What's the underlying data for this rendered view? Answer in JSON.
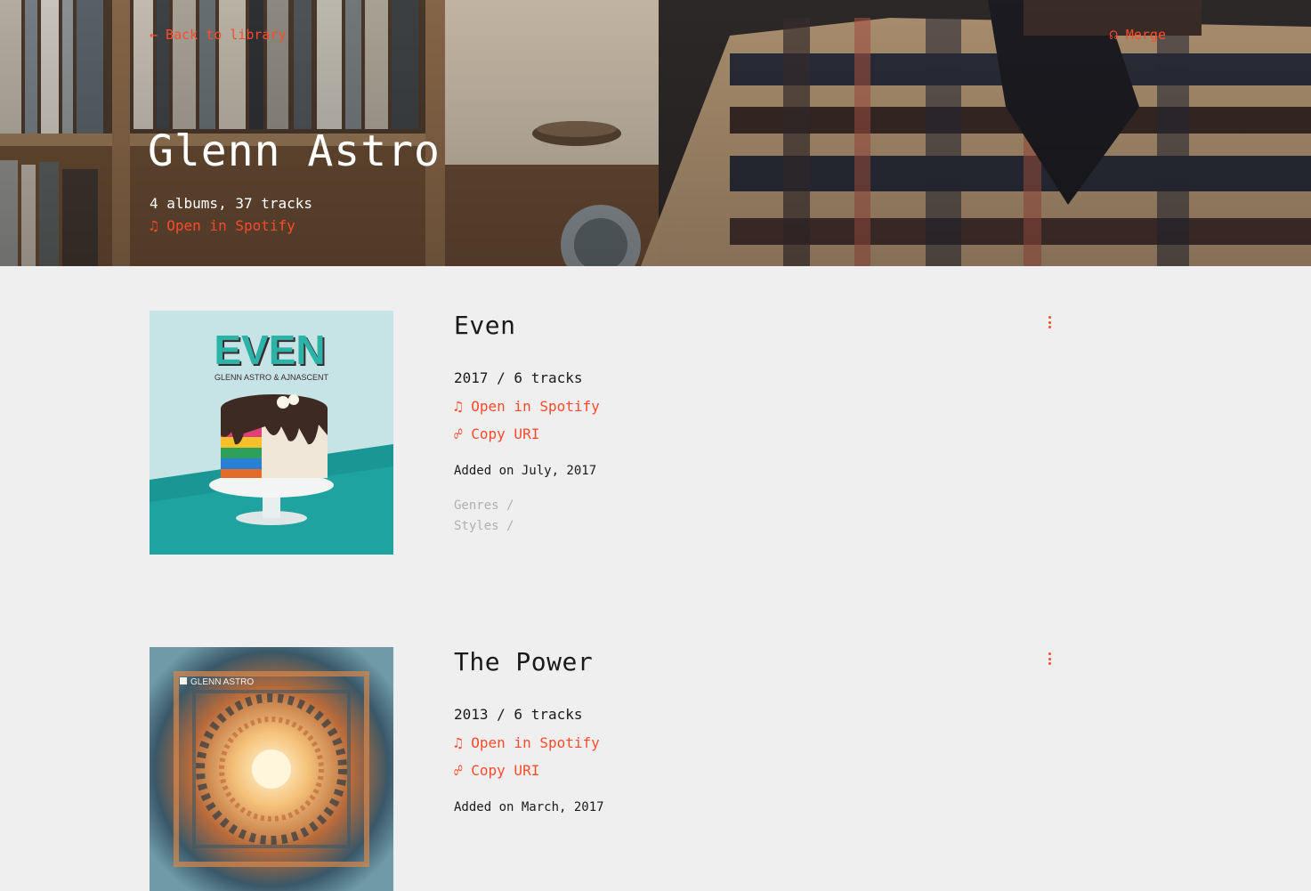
{
  "nav": {
    "back_label": "← Back to library",
    "merge_label": "☊ Merge"
  },
  "artist": {
    "name": "Glenn Astro",
    "stats": "4 albums, 37 tracks",
    "spotify_label": "♫ Open in Spotify"
  },
  "albums": [
    {
      "title": "Even",
      "meta": "2017  /  6 tracks",
      "spotify_label": "♫ Open in Spotify",
      "copy_label": "☍ Copy URI",
      "added": "Added on July, 2017",
      "genres_label": "Genres /",
      "styles_label": "Styles /",
      "cover_text": "EVEN",
      "cover_subtext": "GLENN ASTRO & AJNASCENT"
    },
    {
      "title": "The Power",
      "meta": "2013  /  6 tracks",
      "spotify_label": "♫ Open in Spotify",
      "copy_label": "☍ Copy URI",
      "added": "Added on March, 2017",
      "cover_text": "GLENN ASTRO"
    }
  ],
  "colors": {
    "accent": "#ff4b2b",
    "background": "#efefef",
    "text": "#1a1a1a",
    "muted": "#b0b0b0"
  }
}
